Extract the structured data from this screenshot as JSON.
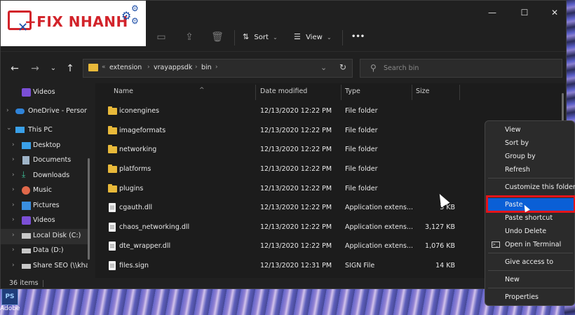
{
  "logo": {
    "text": "+FIX NHANH"
  },
  "window_controls": {
    "minimize": "—",
    "maximize": "☐",
    "close": "✕"
  },
  "toolbar": {
    "sort_label": "Sort",
    "view_label": "View",
    "more_label": "•••"
  },
  "address": {
    "crumbs": [
      "extension",
      "vrayappsdk",
      "bin"
    ],
    "lead": "«"
  },
  "search": {
    "placeholder": "Search bin"
  },
  "sidebar": {
    "items": [
      {
        "label": "Videos",
        "chevron": ""
      },
      {
        "label": "OneDrive - Person",
        "chevron": "›"
      },
      {
        "label": "This PC",
        "chevron": "⌄"
      },
      {
        "label": "Desktop",
        "chevron": "›"
      },
      {
        "label": "Documents",
        "chevron": "›"
      },
      {
        "label": "Downloads",
        "chevron": "›"
      },
      {
        "label": "Music",
        "chevron": "›"
      },
      {
        "label": "Pictures",
        "chevron": "›"
      },
      {
        "label": "Videos",
        "chevron": "›"
      },
      {
        "label": "Local Disk (C:)",
        "chevron": "›"
      },
      {
        "label": "Data (D:)",
        "chevron": "›"
      },
      {
        "label": "Share SEO (\\\\kha",
        "chevron": "›"
      }
    ]
  },
  "columns": {
    "name": "Name",
    "date": "Date modified",
    "type": "Type",
    "size": "Size"
  },
  "files": [
    {
      "name": "iconengines",
      "date": "12/13/2020 12:22 PM",
      "type": "File folder",
      "size": "",
      "kind": "folder"
    },
    {
      "name": "imageformats",
      "date": "12/13/2020 12:22 PM",
      "type": "File folder",
      "size": "",
      "kind": "folder"
    },
    {
      "name": "networking",
      "date": "12/13/2020 12:22 PM",
      "type": "File folder",
      "size": "",
      "kind": "folder"
    },
    {
      "name": "platforms",
      "date": "12/13/2020 12:22 PM",
      "type": "File folder",
      "size": "",
      "kind": "folder"
    },
    {
      "name": "plugins",
      "date": "12/13/2020 12:22 PM",
      "type": "File folder",
      "size": "",
      "kind": "folder"
    },
    {
      "name": "cgauth.dll",
      "date": "12/13/2020 12:22 PM",
      "type": "Application extens...",
      "size": "3 KB",
      "kind": "file"
    },
    {
      "name": "chaos_networking.dll",
      "date": "12/13/2020 12:22 PM",
      "type": "Application extens...",
      "size": "3,127 KB",
      "kind": "file"
    },
    {
      "name": "dte_wrapper.dll",
      "date": "12/13/2020 12:22 PM",
      "type": "Application extens...",
      "size": "1,076 KB",
      "kind": "file"
    },
    {
      "name": "files.sign",
      "date": "12/13/2020 12:31 PM",
      "type": "SIGN File",
      "size": "14 KB",
      "kind": "file"
    }
  ],
  "status": {
    "count": "36 items"
  },
  "context_menu": {
    "items": [
      {
        "label": "View",
        "arrow": ""
      },
      {
        "label": "Sort by",
        "arrow": ""
      },
      {
        "label": "Group by",
        "arrow": ""
      },
      {
        "label": "Refresh",
        "arrow": ""
      },
      {
        "label": "Customize this folder...",
        "arrow": ""
      },
      {
        "label": "Paste",
        "arrow": ""
      },
      {
        "label": "Paste shortcut",
        "arrow": ""
      },
      {
        "label": "Undo Delete",
        "arrow": ""
      },
      {
        "label": "Open in Terminal",
        "arrow": ""
      },
      {
        "label": "Give access to",
        "arrow": ""
      },
      {
        "label": "New",
        "arrow": ""
      },
      {
        "label": "Properties",
        "arrow": ""
      }
    ]
  },
  "desktop": {
    "icon_label": "Adobe",
    "icon_text": "PS"
  },
  "colors": {
    "highlight": "#0a5fd6",
    "annotation_red": "#e4141a",
    "folder": "#e8b93a",
    "logo_red": "#d2232a",
    "logo_blue": "#1e4fa8"
  }
}
